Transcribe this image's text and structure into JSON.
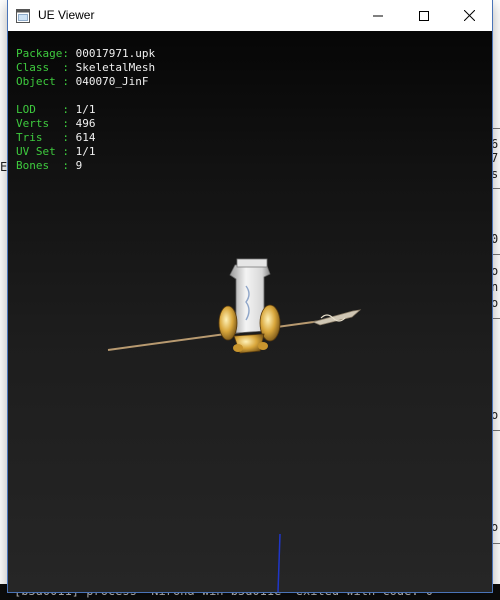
{
  "window": {
    "title": "UE Viewer",
    "icon": "app-window-icon",
    "controls": [
      "minimize-icon",
      "maximize-icon",
      "close-icon"
    ]
  },
  "info": {
    "package": {
      "key": "Package:",
      "value": "00017971.upk"
    },
    "class": {
      "key": "Class  :",
      "value": "SkeletalMesh"
    },
    "object": {
      "key": "Object :",
      "value": "040070_JinF"
    },
    "lod": {
      "key": "LOD    :",
      "value": "1/1"
    },
    "verts": {
      "key": "Verts  :",
      "value": "496"
    },
    "tris": {
      "key": "Tris   :",
      "value": "614"
    },
    "uvset": {
      "key": "UV Set :",
      "value": "1/1"
    },
    "bones": {
      "key": "Bones  :",
      "value": "9"
    }
  },
  "background_console": {
    "fragments": [
      "6",
      "7",
      "s",
      "0",
      "o",
      "n",
      "o",
      "o",
      "o",
      "o"
    ],
    "left_fragment": "E",
    "bottom_text": "[b5d0011] process \"Nirona win b5d011e\" exited with code: 0"
  },
  "colors": {
    "label_green": "#3ecb3e",
    "value_white": "#f0f0f0",
    "viewport_top": "#060606",
    "viewport_bottom": "#262626",
    "axis_blue": "#1f36c8"
  }
}
